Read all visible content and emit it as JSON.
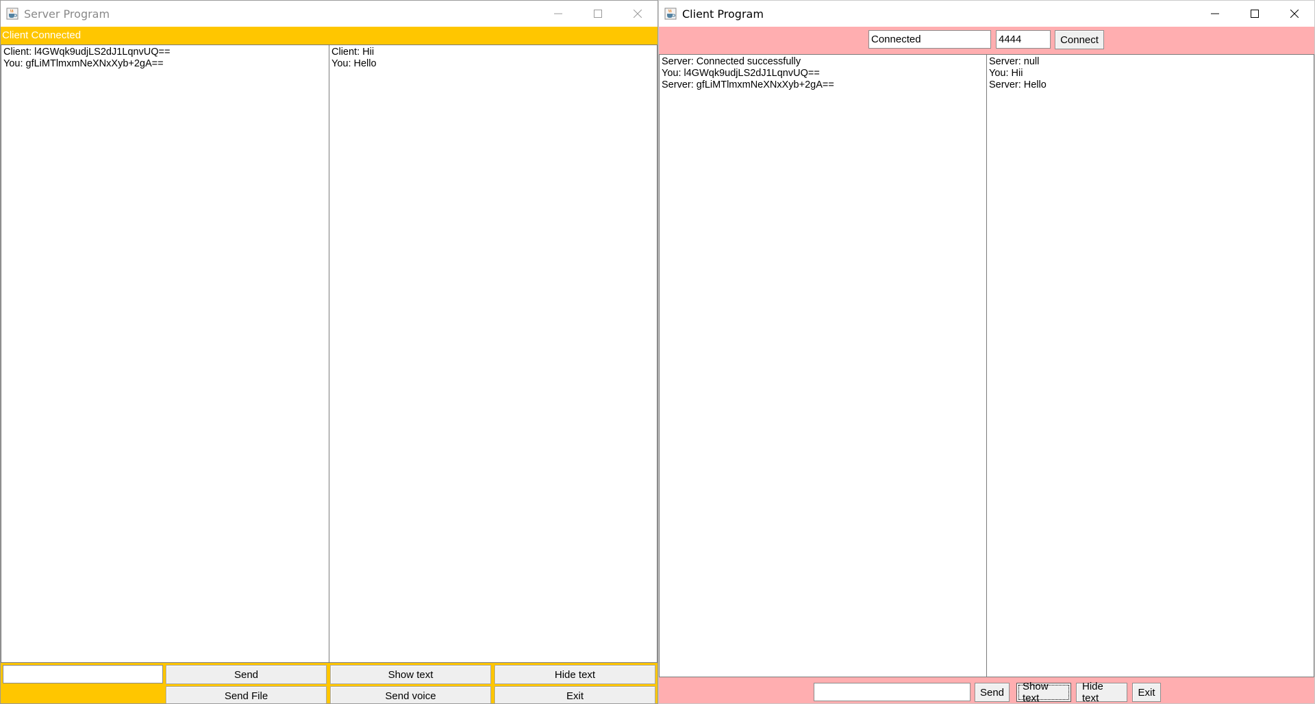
{
  "server": {
    "title": "Server Program",
    "status": "Client Connected",
    "left_messages": [
      "Client: l4GWqk9udjLS2dJ1LqnvUQ==",
      "You: gfLiMTlmxmNeXNxXyb+2gA=="
    ],
    "right_messages": [
      "Client: Hii",
      "You: Hello"
    ],
    "input_value": "",
    "buttons": {
      "send": "Send",
      "show_text": "Show text",
      "hide_text": "Hide text",
      "send_file": "Send File",
      "send_voice": "Send voice",
      "exit": "Exit"
    },
    "banner_color": "#ffc600"
  },
  "client": {
    "title": "Client Program",
    "host_value": "Connected",
    "port_value": "4444",
    "connect_label": "Connect",
    "left_messages": [
      "Server: Connected successfully",
      "You: l4GWqk9udjLS2dJ1LqnvUQ==",
      "Server: gfLiMTlmxmNeXNxXyb+2gA=="
    ],
    "right_messages": [
      "Server: null",
      "You: Hii",
      "Server: Hello"
    ],
    "input_value": "",
    "buttons": {
      "send": "Send",
      "show_text": "Show text",
      "hide_text": "Hide text",
      "exit": "Exit"
    },
    "bar_color": "#ffaeb0"
  },
  "icons": {
    "app_icon": "java-cup-icon",
    "minimize": "minimize-icon",
    "maximize": "maximize-icon",
    "close": "close-icon"
  }
}
